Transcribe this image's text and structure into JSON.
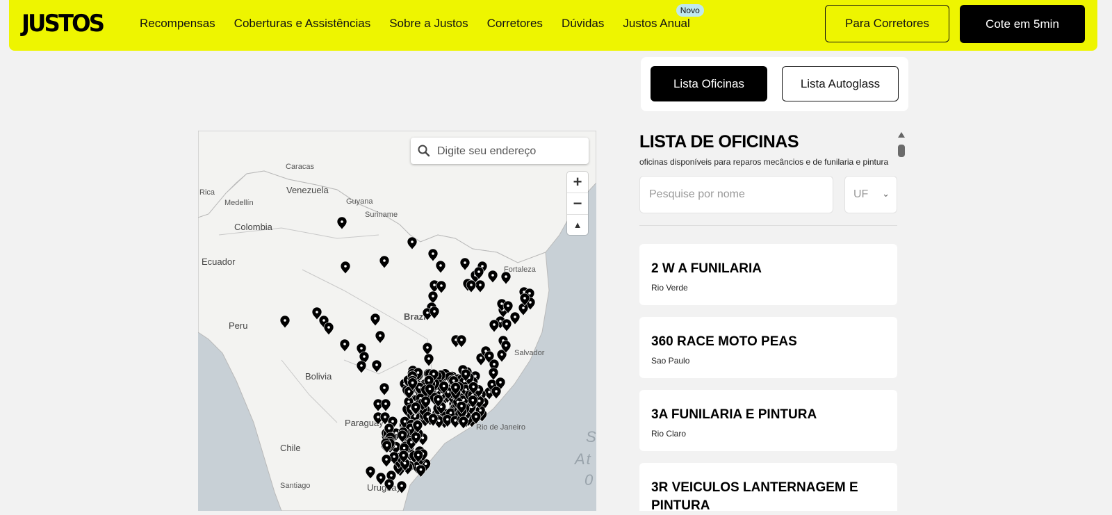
{
  "header": {
    "logo": "JUSTOS",
    "nav": [
      {
        "label": "Recompensas"
      },
      {
        "label": "Coberturas e Assistências"
      },
      {
        "label": "Sobre a Justos"
      },
      {
        "label": "Corretores"
      },
      {
        "label": "Dúvidas"
      },
      {
        "label": "Justos Anual",
        "badge": "Novo"
      }
    ],
    "btn_corretores": "Para Corretores",
    "btn_cote": "Cote em 5min",
    "accent_color": "#eef500"
  },
  "toggle": {
    "active": "Lista Oficinas",
    "inactive": "Lista Autoglass"
  },
  "map": {
    "search_placeholder": "Digite seu endereço",
    "zoom_in": "+",
    "zoom_out": "−",
    "compass": "▲",
    "labels": {
      "caracas": "Caracas",
      "venezuela": "Venezuela",
      "rica": "Rica",
      "medellin": "Medellín",
      "guyana": "Guyana",
      "suriname": "Suriname",
      "colombia": "Colombia",
      "ecuador": "Ecuador",
      "fortaleza": "Fortaleza",
      "brazil": "Brazil",
      "peru": "Peru",
      "salvador": "Salvador",
      "bolivia": "Bolivia",
      "paraguay": "Paraguay",
      "rio": "Rio de Janeiro",
      "chile": "Chile",
      "santiago": "Santiago",
      "uruguay": "Uruguay"
    },
    "ocean": [
      "S",
      "At",
      "0"
    ]
  },
  "list": {
    "title": "LISTA DE OFICINAS",
    "subtitle": "oficinas disponíveis para reparos mecâncios e de funilaria e pintura",
    "name_placeholder": "Pesquise por nome",
    "uf_label": "UF",
    "items": [
      {
        "name": "2 W A FUNILARIA",
        "city": "Rio Verde"
      },
      {
        "name": "360 RACE MOTO PEAS",
        "city": "Sao Paulo"
      },
      {
        "name": "3A FUNILARIA E PINTURA",
        "city": "Rio Claro"
      },
      {
        "name": "3R VEICULOS LANTERNAGEM E PINTURA",
        "city": ""
      }
    ]
  }
}
